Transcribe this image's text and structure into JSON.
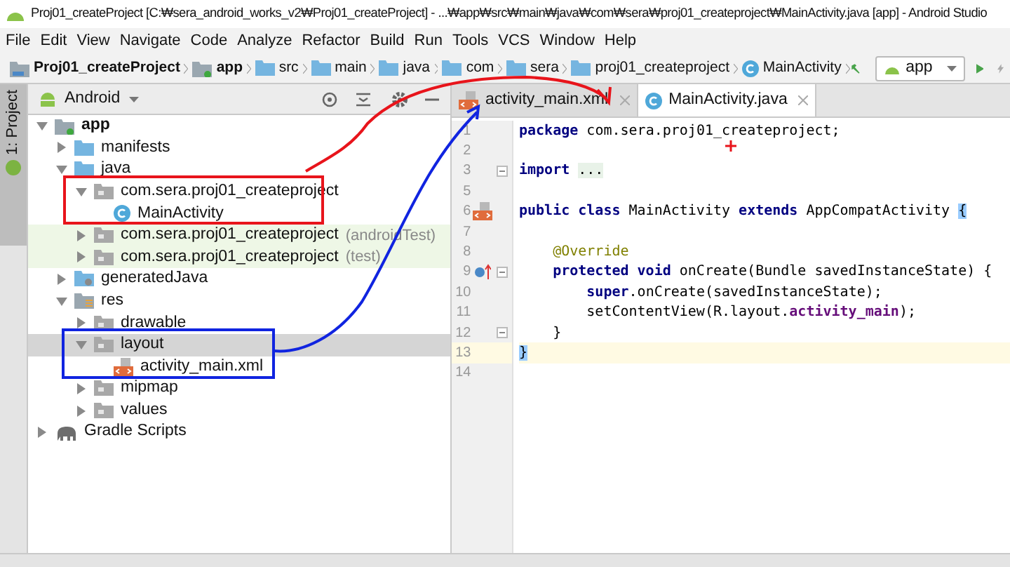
{
  "window": {
    "title": "Proj01_createProject [C:₩sera_android_works_v2₩Proj01_createProject] - ...₩app₩src₩main₩java₩com₩sera₩proj01_createproject₩MainActivity.java [app] - Android Studio"
  },
  "menu": [
    "File",
    "Edit",
    "View",
    "Navigate",
    "Code",
    "Analyze",
    "Refactor",
    "Build",
    "Run",
    "Tools",
    "VCS",
    "Window",
    "Help"
  ],
  "breadcrumb": [
    {
      "label": "Proj01_createProject",
      "kind": "project"
    },
    {
      "label": "app",
      "kind": "module"
    },
    {
      "label": "src",
      "kind": "folder"
    },
    {
      "label": "main",
      "kind": "folder"
    },
    {
      "label": "java",
      "kind": "source"
    },
    {
      "label": "com",
      "kind": "folder"
    },
    {
      "label": "sera",
      "kind": "folder"
    },
    {
      "label": "proj01_createproject",
      "kind": "folder"
    },
    {
      "label": "MainActivity",
      "kind": "class"
    }
  ],
  "run_config": {
    "label": "app"
  },
  "side_tab": {
    "label": "1: Project"
  },
  "project_panel": {
    "view": "Android"
  },
  "tree": [
    {
      "label": "app",
      "kind": "module",
      "expanded": true,
      "selected": false,
      "children": [
        {
          "label": "manifests",
          "kind": "folder",
          "expanded": false,
          "selected": false
        },
        {
          "label": "java",
          "kind": "folder",
          "expanded": true,
          "selected": false,
          "children": [
            {
              "label": "com.sera.proj01_createproject",
              "kind": "package",
              "expanded": true,
              "selected": false,
              "children": [
                {
                  "label": "MainActivity",
                  "kind": "class",
                  "selected": false
                }
              ]
            },
            {
              "label": "com.sera.proj01_createproject",
              "suffix": "(androidTest)",
              "kind": "test-package",
              "expanded": false,
              "selected": false
            },
            {
              "label": "com.sera.proj01_createproject",
              "suffix": "(test)",
              "kind": "test-package",
              "expanded": false,
              "selected": false
            }
          ]
        },
        {
          "label": "generatedJava",
          "kind": "generated",
          "expanded": false,
          "selected": false
        },
        {
          "label": "res",
          "kind": "res",
          "expanded": true,
          "selected": false,
          "children": [
            {
              "label": "drawable",
              "kind": "package",
              "expanded": false,
              "selected": false
            },
            {
              "label": "layout",
              "kind": "package",
              "expanded": true,
              "selected": true,
              "children": [
                {
                  "label": "activity_main.xml",
                  "kind": "xml",
                  "selected": false
                }
              ]
            },
            {
              "label": "mipmap",
              "kind": "package",
              "expanded": false,
              "selected": false
            },
            {
              "label": "values",
              "kind": "package",
              "expanded": false,
              "selected": false
            }
          ]
        }
      ]
    },
    {
      "label": "Gradle Scripts",
      "kind": "gradle",
      "expanded": false,
      "selected": false
    }
  ],
  "tabs": [
    {
      "label": "activity_main.xml",
      "kind": "xml",
      "selected": false
    },
    {
      "label": "MainActivity.java",
      "kind": "class",
      "selected": true
    }
  ],
  "code": [
    {
      "number": "1",
      "kind": "plain",
      "fold": false,
      "current": false,
      "segments": [
        {
          "text": "package",
          "kind": "keyword"
        },
        {
          "text": " com.sera.proj01_createproject;",
          "kind": "plain"
        }
      ]
    },
    {
      "number": "2",
      "kind": "plain",
      "fold": false,
      "current": false
    },
    {
      "number": "3",
      "kind": "plain",
      "fold": true,
      "current": false,
      "segments": [
        {
          "text": "import",
          "kind": "keyword"
        },
        {
          "text": "...",
          "kind": "folded"
        }
      ]
    },
    {
      "number": "5",
      "kind": "plain",
      "fold": false,
      "current": false
    },
    {
      "number": "6",
      "kind": "layout-link",
      "fold": false,
      "current": false,
      "segments": [
        {
          "text": "public class",
          "kind": "keyword"
        },
        {
          "text": " MainActivity ",
          "kind": "plain"
        },
        {
          "text": "extends",
          "kind": "keyword"
        },
        {
          "text": " AppCompatActivity ",
          "kind": "plain"
        },
        {
          "text": "{",
          "kind": "brace"
        }
      ]
    },
    {
      "number": "7",
      "kind": "plain",
      "fold": false,
      "current": false
    },
    {
      "number": "8",
      "kind": "plain",
      "fold": false,
      "current": false,
      "segments": [
        {
          "text": "    @Override",
          "kind": "annotation"
        }
      ]
    },
    {
      "number": "9",
      "kind": "override",
      "fold": true,
      "current": false,
      "segments": [
        {
          "text": "    protected void",
          "kind": "keyword"
        },
        {
          "text": " onCreate(Bundle savedInstanceState) {",
          "kind": "plain"
        }
      ]
    },
    {
      "number": "10",
      "kind": "plain",
      "fold": false,
      "current": false,
      "segments": [
        {
          "text": "        super",
          "kind": "keyword"
        },
        {
          "text": ".onCreate(savedInstanceState);",
          "kind": "plain"
        }
      ]
    },
    {
      "number": "11",
      "kind": "plain",
      "fold": false,
      "current": false,
      "segments": [
        {
          "text": "        setContentView(R.layout.",
          "kind": "plain"
        },
        {
          "text": "activity_main",
          "kind": "field"
        },
        {
          "text": ");",
          "kind": "plain"
        }
      ]
    },
    {
      "number": "12",
      "kind": "plain",
      "fold": true,
      "current": false,
      "segments": [
        {
          "text": "    }",
          "kind": "plain"
        }
      ]
    },
    {
      "number": "13",
      "kind": "plain",
      "fold": false,
      "current": true,
      "segments": [
        {
          "text": "}",
          "kind": "brace"
        }
      ]
    },
    {
      "number": "14",
      "kind": "plain",
      "fold": false,
      "current": false
    }
  ]
}
